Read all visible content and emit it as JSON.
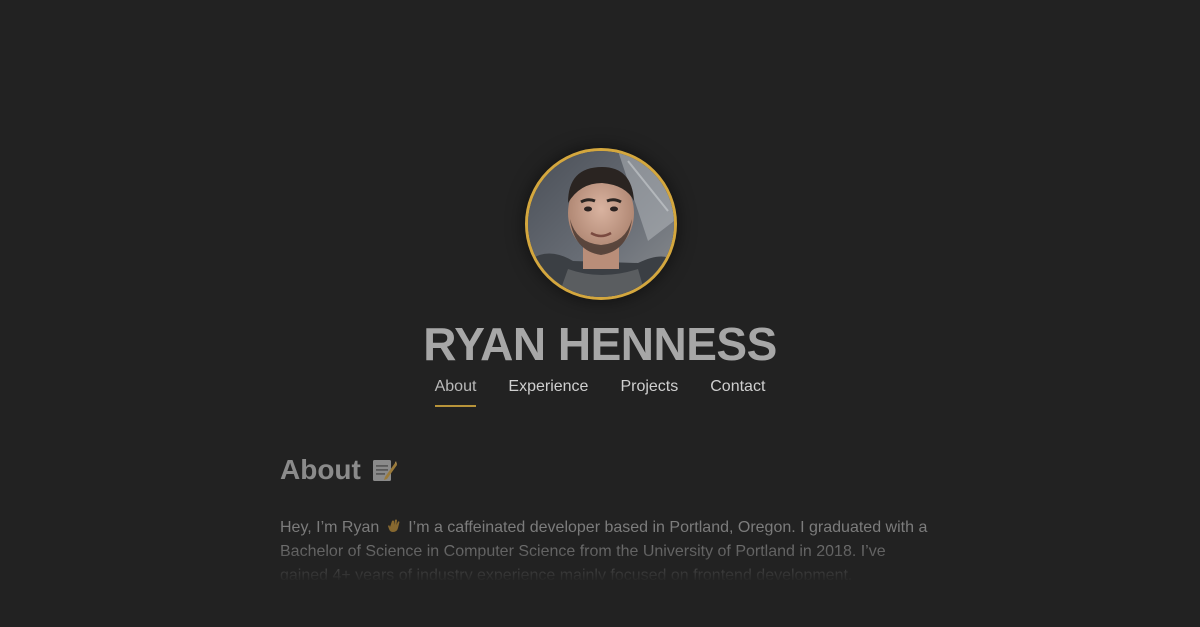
{
  "profile": {
    "name": "RYAN HENNESS",
    "avatar_icon": "profile-photo",
    "accent_color": "#d4a73e"
  },
  "nav": {
    "items": [
      {
        "label": "About",
        "active": true
      },
      {
        "label": "Experience",
        "active": false
      },
      {
        "label": "Projects",
        "active": false
      },
      {
        "label": "Contact",
        "active": false
      }
    ]
  },
  "about": {
    "title": "About",
    "title_icon": "memo-icon",
    "intro_before_icon": "Hey, I’m Ryan",
    "intro_icon": "waving-hand-icon",
    "intro_after_icon": "I’m a caffeinated developer based in Portland, Oregon. I graduated with a Bachelor of Science in Computer Science from the University of Portland in 2018. I’ve gained 4+ years of industry experience mainly focused on frontend development."
  },
  "colors": {
    "background": "#222222",
    "accent": "#d4a73e",
    "name_text": "#a7a7a7",
    "nav_text": "#cfcfcf",
    "body_text": "#7e7e7e"
  }
}
